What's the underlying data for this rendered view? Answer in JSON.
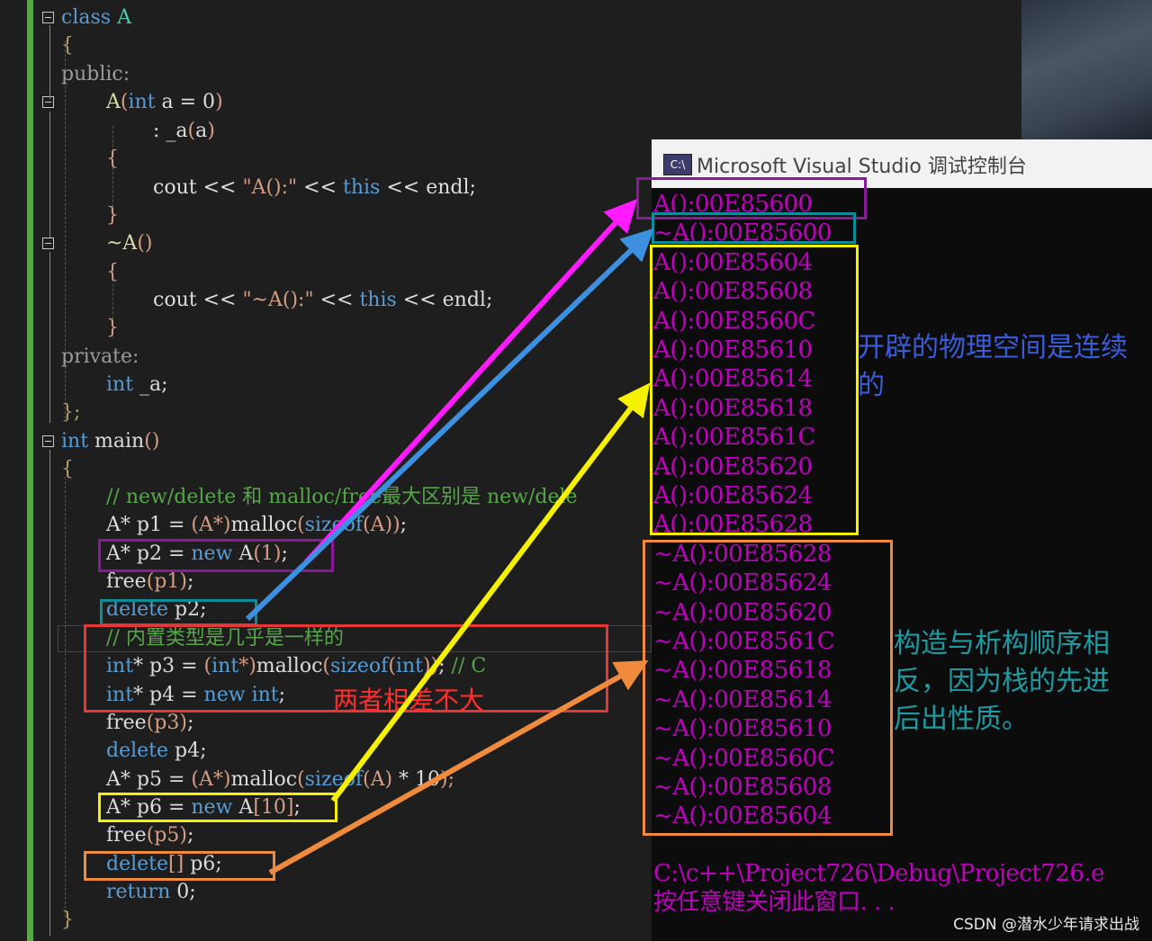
{
  "code": {
    "l1": {
      "kw": "class",
      "name": "A"
    },
    "l2": "{",
    "l3": {
      "kw": "public",
      "colon": ":"
    },
    "l4": {
      "fn": "A",
      "open": "(",
      "kw": "int",
      "rest": " a = 0",
      "close": ")"
    },
    "l5": {
      "pre": ": _a",
      "open": "(",
      "arg": "a",
      "close": ")"
    },
    "l6": "{",
    "l7": {
      "pre": "cout << ",
      "str": "\"A():\"",
      "mid": " << ",
      "kw": "this",
      "post": " << endl;"
    },
    "l8": "}",
    "l9": {
      "tilde": "~A",
      "parens": "()"
    },
    "l10": "{",
    "l11": {
      "pre": "cout << ",
      "str": "\"~A():\"",
      "mid": " << ",
      "kw": "this",
      "post": " << endl;"
    },
    "l12": "}",
    "l13": {
      "kw": "private",
      "colon": ":"
    },
    "l14": {
      "kw": "int",
      "rest": " _a;"
    },
    "l15": "};",
    "l16": {
      "kw": "int",
      "rest": " main",
      "parens": "()"
    },
    "l17": "{",
    "l18": "// new/delete 和 malloc/free最大区别是 new/dele",
    "l19": {
      "a": "A* p1 = ",
      "cast": "(A*)",
      "b": "malloc",
      "c": "(",
      "d": "sizeof",
      "e": "(A)",
      "f": ")",
      "g": ";"
    },
    "l20": {
      "a": "A* p2 = ",
      "kw": "new",
      "b": " A",
      "c": "(1)",
      "d": ";"
    },
    "l21": {
      "a": "free",
      "b": "(p1)",
      "c": ";"
    },
    "l22": {
      "kw": "delete",
      "rest": " p2;"
    },
    "l23": "// 内置类型是几乎是一样的",
    "l24": {
      "kw": "int",
      "a": "* p3 = ",
      "b": "(",
      "kw2": "int",
      "c": "*)",
      "d": "malloc",
      "e": "(",
      "kw3": "sizeof",
      "f": "(",
      "kw4": "int",
      "g": "))",
      "h": "; ",
      "cmt": "// C"
    },
    "l25": {
      "kw": "int",
      "a": "* p4 = ",
      "kw2": "new",
      "b": " ",
      "kw3": "int",
      "c": ";"
    },
    "l26": {
      "a": "free",
      "b": "(p3)",
      "c": ";"
    },
    "l27": {
      "kw": "delete",
      "rest": " p4;"
    },
    "l28": {
      "a": "A* p5 = ",
      "cast": "(A*)",
      "b": "malloc",
      "c": "(",
      "d": "sizeof",
      "e": "(A)",
      "f": " * 10",
      "g": ");"
    },
    "l29": {
      "a": "A* p6 = ",
      "kw": "new",
      "b": " A",
      "c": "[10]",
      "d": ";"
    },
    "l30": {
      "a": "free",
      "b": "(p5)",
      "c": ";"
    },
    "l31": {
      "kw": "delete",
      "b": "[]",
      "rest": " p6;"
    },
    "l32": {
      "kw": "return",
      "rest": " 0;"
    },
    "l33": "}"
  },
  "console": {
    "title": "Microsoft Visual Studio 调试控制台",
    "icon_text": "C:\\",
    "lines": [
      "A():00E85600",
      "~A():00E85600",
      "A():00E85604",
      "A():00E85608",
      "A():00E8560C",
      "A():00E85610",
      "A():00E85614",
      "A():00E85618",
      "A():00E8561C",
      "A():00E85620",
      "A():00E85624",
      "A():00E85628",
      "~A():00E85628",
      "~A():00E85624",
      "~A():00E85620",
      "~A():00E8561C",
      "~A():00E85618",
      "~A():00E85614",
      "~A():00E85610",
      "~A():00E8560C",
      "~A():00E85608",
      "~A():00E85604"
    ],
    "path": "C:\\c++\\Project726\\Debug\\Project726.e",
    "press_key": "按任意键关闭此窗口. . ."
  },
  "annotations": {
    "contiguous": "开辟的物理空间是连续\n的",
    "order": "构造与析构顺序相\n反，因为栈的先进\n后出性质。",
    "similar": "两者相差不大"
  },
  "watermark": "CSDN @潜水少年请求出战",
  "colors": {
    "purple": "#8b1a9b",
    "teal": "#0e8c98",
    "yellow": "#f5f100",
    "orange": "#f08a3c",
    "red": "#e83535",
    "magenta_arrow": "#ff1aff",
    "blue_arrow": "#3d8fe0",
    "console_text": "#bf00bf"
  }
}
